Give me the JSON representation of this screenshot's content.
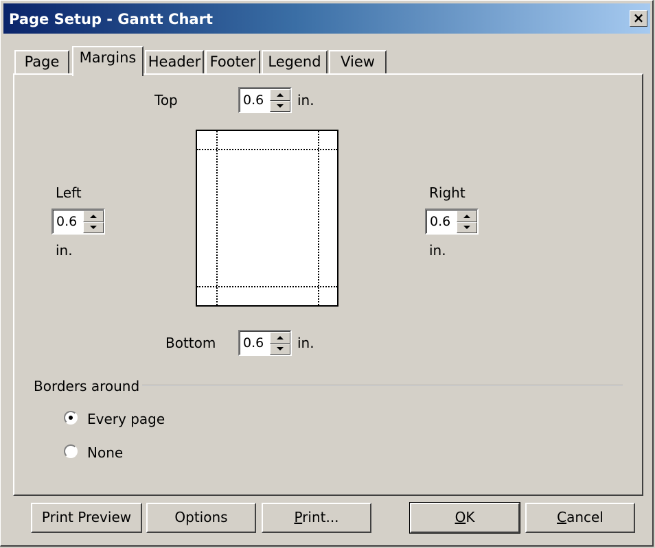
{
  "window": {
    "title": "Page Setup - Gantt Chart",
    "close_label": "×"
  },
  "tabs": [
    {
      "label": "Page",
      "active": false
    },
    {
      "label": "Margins",
      "active": true
    },
    {
      "label": "Header",
      "active": false
    },
    {
      "label": "Footer",
      "active": false
    },
    {
      "label": "Legend",
      "active": false
    },
    {
      "label": "View",
      "active": false
    }
  ],
  "margins": {
    "top": {
      "label": "Top",
      "value": "0.6",
      "unit": "in."
    },
    "left": {
      "label": "Left",
      "value": "0.6",
      "unit": "in."
    },
    "right": {
      "label": "Right",
      "value": "0.6",
      "unit": "in."
    },
    "bottom": {
      "label": "Bottom",
      "value": "0.6",
      "unit": "in."
    }
  },
  "borders": {
    "group_label": "Borders around",
    "options": [
      {
        "label": "Every page",
        "selected": true
      },
      {
        "label": "None",
        "selected": false
      }
    ]
  },
  "buttons": {
    "print_preview": "Print Preview",
    "options": "Options",
    "print_prefix": "P",
    "print_rest": "rint...",
    "ok_prefix": "O",
    "ok_rest": "K",
    "cancel_prefix": "C",
    "cancel_rest": "ancel"
  }
}
